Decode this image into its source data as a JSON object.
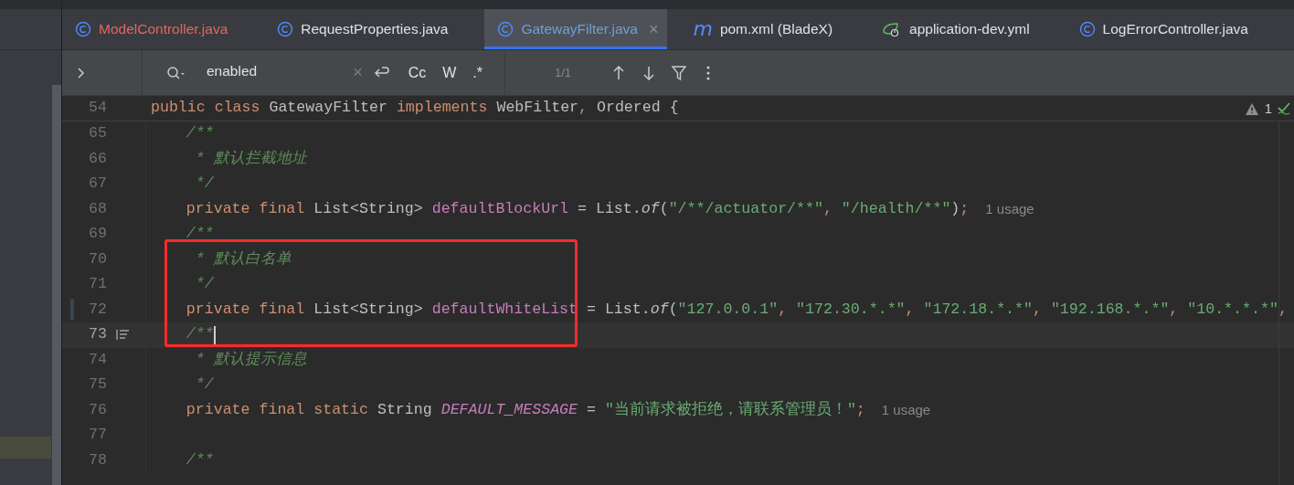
{
  "tabs": [
    {
      "label": "ModelController.java",
      "kind": "class",
      "error": true,
      "selected": false
    },
    {
      "label": "RequestProperties.java",
      "kind": "class",
      "error": false,
      "selected": false
    },
    {
      "label": "GatewayFilter.java",
      "kind": "class",
      "error": false,
      "selected": true,
      "close": "×"
    },
    {
      "label": "pom.xml (BladeX)",
      "kind": "maven",
      "glyph": "m",
      "error": false,
      "selected": false
    },
    {
      "label": "application-dev.yml",
      "kind": "spring",
      "error": false,
      "selected": false
    },
    {
      "label": "LogErrorController.java",
      "kind": "class",
      "error": false,
      "selected": false
    }
  ],
  "search": {
    "value": "enabled",
    "clear": "×",
    "options": [
      {
        "label": "Cc",
        "selected": false
      },
      {
        "label": "W",
        "selected": false
      },
      {
        "label": ".*",
        "selected": false
      }
    ],
    "count": "1/1"
  },
  "inspections": {
    "warnings": "1"
  },
  "sticky_line": {
    "number": "54",
    "tokens": [
      {
        "kind": "kw",
        "t": "public class "
      },
      {
        "kind": "text",
        "t": "GatewayFilter "
      },
      {
        "kind": "kw",
        "t": "implements "
      },
      {
        "kind": "text",
        "t": "WebFilter"
      },
      {
        "kind": "punct",
        "t": ", "
      },
      {
        "kind": "text",
        "t": "Ordered {"
      }
    ]
  },
  "lines": [
    {
      "number": "65",
      "current": false,
      "changed": false,
      "tokens": [
        {
          "kind": "comment",
          "t": "    /**"
        }
      ]
    },
    {
      "number": "66",
      "current": false,
      "changed": false,
      "tokens": [
        {
          "kind": "comment",
          "t": "     * 默认拦截地址"
        }
      ]
    },
    {
      "number": "67",
      "current": false,
      "changed": false,
      "tokens": [
        {
          "kind": "comment",
          "t": "     */"
        }
      ]
    },
    {
      "number": "68",
      "current": false,
      "changed": false,
      "tokens": [
        {
          "kind": "kw",
          "t": "    private final "
        },
        {
          "kind": "text",
          "t": "List<String> "
        },
        {
          "kind": "field",
          "t": "defaultBlockUrl"
        },
        {
          "kind": "text",
          "t": " = List."
        },
        {
          "kind": "method",
          "t": "of"
        },
        {
          "kind": "text",
          "t": "("
        },
        {
          "kind": "string",
          "t": "\"/**/actuator/**\""
        },
        {
          "kind": "punct",
          "t": ", "
        },
        {
          "kind": "string",
          "t": "\"/health/**\""
        },
        {
          "kind": "text",
          "t": ")"
        },
        {
          "kind": "punct",
          "t": ";"
        }
      ],
      "hint": "1 usage"
    },
    {
      "number": "69",
      "current": false,
      "changed": false,
      "tokens": [
        {
          "kind": "comment",
          "t": "    /**"
        }
      ]
    },
    {
      "number": "70",
      "current": false,
      "changed": false,
      "tokens": [
        {
          "kind": "comment",
          "t": "     * 默认白名单"
        }
      ]
    },
    {
      "number": "71",
      "current": false,
      "changed": false,
      "tokens": [
        {
          "kind": "comment",
          "t": "     */"
        }
      ]
    },
    {
      "number": "72",
      "current": false,
      "changed": true,
      "tokens": [
        {
          "kind": "kw",
          "t": "    private final "
        },
        {
          "kind": "text",
          "t": "List<String> "
        },
        {
          "kind": "field",
          "t": "defaultWhiteList"
        },
        {
          "kind": "text",
          "t": " = List."
        },
        {
          "kind": "method",
          "t": "of"
        },
        {
          "kind": "text",
          "t": "("
        },
        {
          "kind": "string",
          "t": "\"127.0.0.1\""
        },
        {
          "kind": "punct",
          "t": ", "
        },
        {
          "kind": "string",
          "t": "\"172.30.*.*\""
        },
        {
          "kind": "punct",
          "t": ", "
        },
        {
          "kind": "string",
          "t": "\"172.18.*.*\""
        },
        {
          "kind": "punct",
          "t": ", "
        },
        {
          "kind": "string",
          "t": "\"192.168.*.*\""
        },
        {
          "kind": "punct",
          "t": ", "
        },
        {
          "kind": "string",
          "t": "\"10.*.*.*\""
        },
        {
          "kind": "punct",
          "t": ","
        }
      ]
    },
    {
      "number": "73",
      "current": true,
      "changed": false,
      "tokens": [
        {
          "kind": "comment",
          "t": "    /**"
        }
      ]
    },
    {
      "number": "74",
      "current": false,
      "changed": false,
      "tokens": [
        {
          "kind": "comment",
          "t": "     * 默认提示信息"
        }
      ]
    },
    {
      "number": "75",
      "current": false,
      "changed": false,
      "tokens": [
        {
          "kind": "comment",
          "t": "     */"
        }
      ]
    },
    {
      "number": "76",
      "current": false,
      "changed": false,
      "tokens": [
        {
          "kind": "kw",
          "t": "    private final static "
        },
        {
          "kind": "text",
          "t": "String "
        },
        {
          "kind": "constant",
          "t": "DEFAULT_MESSAGE"
        },
        {
          "kind": "text",
          "t": " = "
        },
        {
          "kind": "string",
          "t": "\"当前请求被拒绝，请联系管理员！\""
        },
        {
          "kind": "punct",
          "t": ";"
        }
      ],
      "hint": "1 usage"
    },
    {
      "number": "77",
      "current": false,
      "changed": false
    },
    {
      "number": "78",
      "current": false,
      "changed": false,
      "tokens": [
        {
          "kind": "comment",
          "t": "    /**"
        }
      ]
    }
  ]
}
